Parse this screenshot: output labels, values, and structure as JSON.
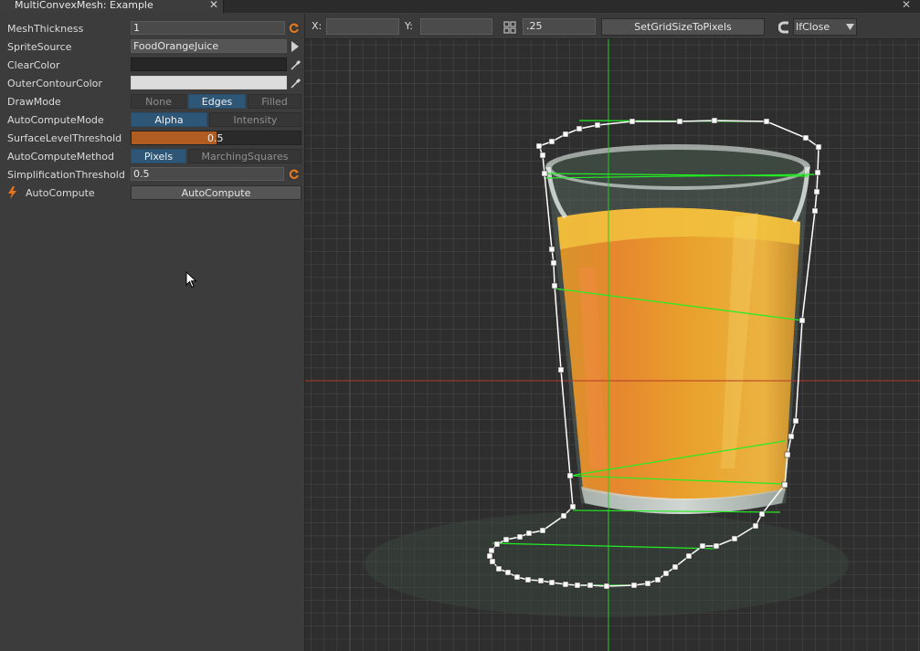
{
  "window": {
    "tab_title": "MultiConvexMesh: Example",
    "tab_close": "✕",
    "close": "✕"
  },
  "properties": {
    "mesh_thickness": {
      "label": "MeshThickness",
      "value": "1"
    },
    "sprite_source": {
      "label": "SpriteSource",
      "value": "FoodOrangeJuice"
    },
    "clear_color": {
      "label": "ClearColor",
      "color": "#262626"
    },
    "outer_contour_color": {
      "label": "OuterContourColor",
      "color": "#dcdcdc"
    },
    "draw_mode": {
      "label": "DrawMode",
      "options": [
        "None",
        "Edges",
        "Filled"
      ],
      "selected": "Edges"
    },
    "auto_compute_mode": {
      "label": "AutoComputeMode",
      "options": [
        "Alpha",
        "Intensity"
      ],
      "selected": "Alpha"
    },
    "surface_level_threshold": {
      "label": "SurfaceLevelThreshold",
      "value": "0.5",
      "fraction": 0.5
    },
    "auto_compute_method": {
      "label": "AutoComputeMethod",
      "options": [
        "Pixels",
        "MarchingSquares"
      ],
      "selected": "Pixels"
    },
    "simplification_threshold": {
      "label": "SimplificationThreshold",
      "value": "0.5"
    },
    "auto_compute": {
      "label": "AutoCompute",
      "button": "AutoCompute"
    }
  },
  "toolbar": {
    "x_label": "X:",
    "x_value": "",
    "y_label": "Y:",
    "y_value": "",
    "grid_size": ".25",
    "set_grid_button": "SetGridSizeToPixels",
    "snap_mode": "IfClose"
  },
  "colors": {
    "accent_blue": "#2e5676",
    "slider_orange": "#b15c20",
    "grid_line": "#5a5a5a",
    "axis_x": "#b23a2a",
    "axis_y": "#22cc22",
    "edge_green": "#22ee22",
    "outline": "#ffffff"
  },
  "icons": {
    "reset": "reset-icon",
    "expand": "play-arrow-icon",
    "picker": "eyedropper-icon",
    "lightning": "lightning-icon",
    "grid": "grid-icon",
    "magnet": "magnet-icon",
    "dropdown": "chevron-down-icon",
    "cursor": "mouse-cursor-icon"
  }
}
